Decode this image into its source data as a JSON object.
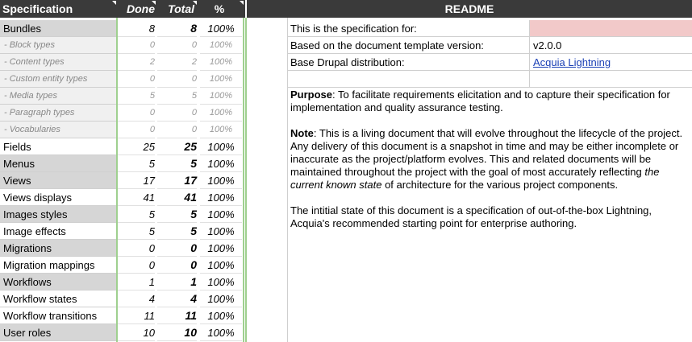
{
  "spec": {
    "headers": {
      "name": "Specification",
      "done": "Done",
      "total": "Total",
      "pct": "%"
    },
    "rows": [
      {
        "name": "Bundles",
        "done": "8",
        "total": "8",
        "pct": "100%",
        "kind": "shade"
      },
      {
        "name": "- Block types",
        "done": "0",
        "total": "0",
        "pct": "100%",
        "kind": "sub"
      },
      {
        "name": "- Content types",
        "done": "2",
        "total": "2",
        "pct": "100%",
        "kind": "sub"
      },
      {
        "name": "- Custom entity types",
        "done": "0",
        "total": "0",
        "pct": "100%",
        "kind": "sub"
      },
      {
        "name": "- Media types",
        "done": "5",
        "total": "5",
        "pct": "100%",
        "kind": "sub"
      },
      {
        "name": "- Paragraph types",
        "done": "0",
        "total": "0",
        "pct": "100%",
        "kind": "sub"
      },
      {
        "name": "- Vocabularies",
        "done": "0",
        "total": "0",
        "pct": "100%",
        "kind": "sub"
      },
      {
        "name": "Fields",
        "done": "25",
        "total": "25",
        "pct": "100%",
        "kind": "plain"
      },
      {
        "name": "Menus",
        "done": "5",
        "total": "5",
        "pct": "100%",
        "kind": "shade"
      },
      {
        "name": "Views",
        "done": "17",
        "total": "17",
        "pct": "100%",
        "kind": "shade"
      },
      {
        "name": "Views displays",
        "done": "41",
        "total": "41",
        "pct": "100%",
        "kind": "plain"
      },
      {
        "name": "Images styles",
        "done": "5",
        "total": "5",
        "pct": "100%",
        "kind": "shade"
      },
      {
        "name": "Image effects",
        "done": "5",
        "total": "5",
        "pct": "100%",
        "kind": "plain"
      },
      {
        "name": "Migrations",
        "done": "0",
        "total": "0",
        "pct": "100%",
        "kind": "shade"
      },
      {
        "name": "Migration mappings",
        "done": "0",
        "total": "0",
        "pct": "100%",
        "kind": "plain"
      },
      {
        "name": "Workflows",
        "done": "1",
        "total": "1",
        "pct": "100%",
        "kind": "shade"
      },
      {
        "name": "Workflow states",
        "done": "4",
        "total": "4",
        "pct": "100%",
        "kind": "plain"
      },
      {
        "name": "Workflow transitions",
        "done": "11",
        "total": "11",
        "pct": "100%",
        "kind": "plain"
      },
      {
        "name": "User roles",
        "done": "10",
        "total": "10",
        "pct": "100%",
        "kind": "shade"
      }
    ]
  },
  "readme": {
    "title": "README",
    "fields": [
      {
        "label": "This is the specification for:",
        "value": ""
      },
      {
        "label": "Based on the document template version:",
        "value": "v2.0.0"
      },
      {
        "label": "Base Drupal distribution:",
        "value": "Acquia Lightning"
      },
      {
        "label": "",
        "value": ""
      }
    ],
    "purpose_label": "Purpose",
    "purpose_text": ": To facilitate requirements elicitation and to capture their specification for implementation and quality assurance testing.",
    "note_label": "Note",
    "note_text_1": ": This is a living document that will evolve throughout the lifecycle of the project. Any delivery of this document is a snapshot in time and may be either incomplete or inaccurate as the project/platform evolves. This and related documents will be maintained throughout the project with the goal of most accurately reflecting ",
    "note_emph": "the current known state",
    "note_text_2": " of architecture for the various project components.",
    "initial_text": "The intitial state of this document is a specification of out-of-the-box Lightning, Acquia's recommended starting point for enterprise authoring."
  },
  "colors": {
    "header_bg": "#3a3a3a",
    "green_divider": "#9fd08f",
    "pink_cell": "#f2c9c9",
    "link": "#1a3fb5"
  }
}
